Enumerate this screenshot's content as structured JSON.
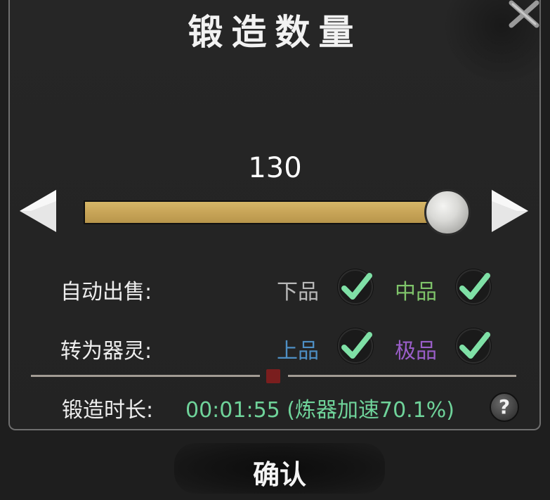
{
  "dialog": {
    "title": "锻造数量"
  },
  "quantity": {
    "value": "130",
    "slider_fraction": 1.0
  },
  "auto_sell": {
    "label": "自动出售:",
    "options": [
      {
        "grade": "下品",
        "color": "#b9b9b9",
        "checked": true
      },
      {
        "grade": "中品",
        "color": "#7fc46a",
        "checked": true
      }
    ]
  },
  "convert_spirit": {
    "label": "转为器灵:",
    "options": [
      {
        "grade": "上品",
        "color": "#4e8fc4",
        "checked": true
      },
      {
        "grade": "极品",
        "color": "#9a5ec9",
        "checked": true
      }
    ]
  },
  "duration": {
    "label": "锻造时长:",
    "value": "00:01:55 (炼器加速70.1%)"
  },
  "help": {
    "symbol": "?"
  },
  "confirm": {
    "label": "确认"
  },
  "colors": {
    "slider_fill": "#c9a659",
    "check_mark": "#7fe0a6",
    "duration_text": "#6fd39a"
  },
  "icons": {
    "close": "close-x-icon",
    "decrease": "arrow-left-icon",
    "increase": "arrow-right-icon",
    "check": "checkmark-icon",
    "help": "question-icon"
  }
}
